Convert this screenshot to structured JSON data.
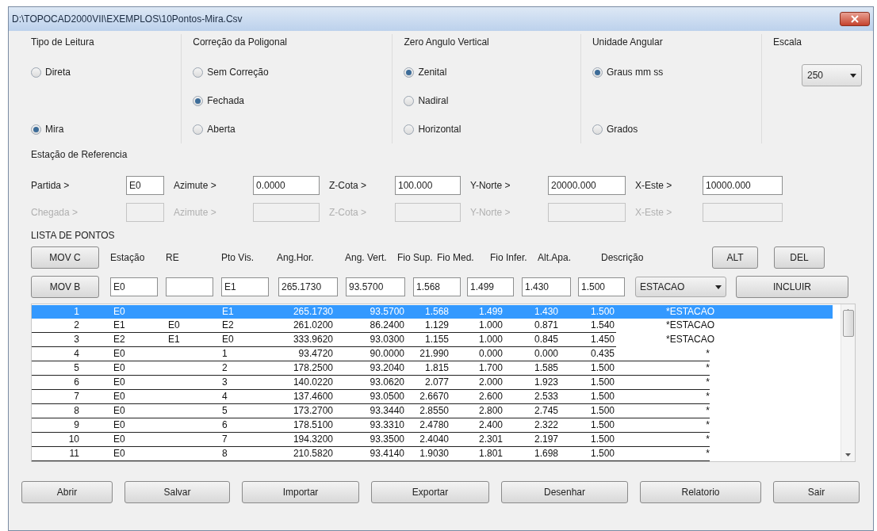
{
  "window": {
    "title": "D:\\TOPOCAD2000VII\\EXEMPLOS\\10Pontos-Mira.Csv"
  },
  "option_groups": [
    {
      "title": "Tipo de Leitura",
      "options": [
        {
          "label": "Direta",
          "selected": false
        },
        {
          "label": "Mira",
          "selected": true
        }
      ]
    },
    {
      "title": "Correção da Poligonal",
      "options": [
        {
          "label": "Sem Correção",
          "selected": false
        },
        {
          "label": "Fechada",
          "selected": true
        },
        {
          "label": "Aberta",
          "selected": false
        }
      ]
    },
    {
      "title": "Zero Angulo Vertical",
      "options": [
        {
          "label": "Zenital",
          "selected": true
        },
        {
          "label": "Nadiral",
          "selected": false
        },
        {
          "label": "Horizontal",
          "selected": false
        }
      ]
    },
    {
      "title": "Unidade Angular",
      "options": [
        {
          "label": "Graus mm ss",
          "selected": true
        },
        {
          "label": "Grados",
          "selected": false
        }
      ]
    }
  ],
  "escala": {
    "title": "Escala",
    "value": "250"
  },
  "reference": {
    "title": "Estação de Referencia",
    "rows": [
      {
        "disabled": false,
        "fields": [
          {
            "label": "Partida >",
            "value": "E0"
          },
          {
            "label": "Azimute >",
            "value": "0.0000"
          },
          {
            "label": "Z-Cota >",
            "value": "100.000"
          },
          {
            "label": "Y-Norte >",
            "value": "20000.000"
          },
          {
            "label": "X-Este >",
            "value": "10000.000"
          }
        ]
      },
      {
        "disabled": true,
        "fields": [
          {
            "label": "Chegada >"
          },
          {
            "label": "Azimute >"
          },
          {
            "label": "Z-Cota >"
          },
          {
            "label": "Y-Norte >"
          },
          {
            "label": "X-Este >"
          }
        ]
      }
    ]
  },
  "points": {
    "title": "LISTA DE PONTOS",
    "mov_buttons": [
      "MOV C",
      "MOV B"
    ],
    "columns": [
      "Estação",
      "RE",
      "Pto Vis.",
      "Ang.Hor.",
      "Ang. Vert.",
      "Fio Sup.",
      "Fio Med.",
      "Fio Infer.",
      "Alt.Apa.",
      "Descrição"
    ],
    "side_buttons": [
      "ALT",
      "DEL"
    ],
    "entry": {
      "estacao": "E0",
      "pto_vis": "E1",
      "ang_hor": "265.1730",
      "ang_vert": "93.5700",
      "fio_sup": "1.568",
      "fio_med": "1.499",
      "fio_infer": "1.430",
      "alt_apa": "1.500",
      "descricao": "ESTACAO"
    },
    "include_button": "INCLUIR",
    "rows": [
      {
        "n": "1",
        "estacao": "E0",
        "pto_vis": "E1",
        "ang_hor": "265.1730",
        "ang_vert": "93.5700",
        "fio_sup": "1.568",
        "fio_med": "1.499",
        "fio_infer": "1.430",
        "alt_apa": "1.500",
        "descricao": "*ESTACAO",
        "selected": true
      },
      {
        "n": "2",
        "estacao": "E1",
        "re": "E0",
        "pto_vis": "E2",
        "ang_hor": "261.0200",
        "ang_vert": "86.2400",
        "fio_sup": "1.129",
        "fio_med": "1.000",
        "fio_infer": "0.871",
        "alt_apa": "1.540",
        "descricao": "*ESTACAO",
        "selected": false
      },
      {
        "n": "3",
        "estacao": "E2",
        "re": "E1",
        "pto_vis": "E0",
        "ang_hor": "333.9620",
        "ang_vert": "93.0300",
        "fio_sup": "1.155",
        "fio_med": "1.000",
        "fio_infer": "0.845",
        "alt_apa": "1.450",
        "descricao": "*ESTACAO",
        "selected": false
      },
      {
        "n": "4",
        "estacao": "E0",
        "pto_vis": "1",
        "ang_hor": "93.4720",
        "ang_vert": "90.0000",
        "fio_sup": "21.990",
        "fio_med": "0.000",
        "fio_infer": "0.000",
        "alt_apa": "0.435",
        "descricao": "*",
        "selected": false
      },
      {
        "n": "5",
        "estacao": "E0",
        "pto_vis": "2",
        "ang_hor": "178.2500",
        "ang_vert": "93.2040",
        "fio_sup": "1.815",
        "fio_med": "1.700",
        "fio_infer": "1.585",
        "alt_apa": "1.500",
        "descricao": "*",
        "selected": false
      },
      {
        "n": "6",
        "estacao": "E0",
        "pto_vis": "3",
        "ang_hor": "140.0220",
        "ang_vert": "93.0620",
        "fio_sup": "2.077",
        "fio_med": "2.000",
        "fio_infer": "1.923",
        "alt_apa": "1.500",
        "descricao": "*",
        "selected": false
      },
      {
        "n": "7",
        "estacao": "E0",
        "pto_vis": "4",
        "ang_hor": "137.4600",
        "ang_vert": "93.0500",
        "fio_sup": "2.6670",
        "fio_med": "2.600",
        "fio_infer": "2.533",
        "alt_apa": "1.500",
        "descricao": "*",
        "selected": false
      },
      {
        "n": "8",
        "estacao": "E0",
        "pto_vis": "5",
        "ang_hor": "173.2700",
        "ang_vert": "93.3440",
        "fio_sup": "2.8550",
        "fio_med": "2.800",
        "fio_infer": "2.745",
        "alt_apa": "1.500",
        "descricao": "*",
        "selected": false
      },
      {
        "n": "9",
        "estacao": "E0",
        "pto_vis": "6",
        "ang_hor": "178.5100",
        "ang_vert": "93.3310",
        "fio_sup": "2.4780",
        "fio_med": "2.400",
        "fio_infer": "2.322",
        "alt_apa": "1.500",
        "descricao": "*",
        "selected": false
      },
      {
        "n": "10",
        "estacao": "E0",
        "pto_vis": "7",
        "ang_hor": "194.3200",
        "ang_vert": "93.3500",
        "fio_sup": "2.4040",
        "fio_med": "2.301",
        "fio_infer": "2.197",
        "alt_apa": "1.500",
        "descricao": "*",
        "selected": false
      },
      {
        "n": "11",
        "estacao": "E0",
        "pto_vis": "8",
        "ang_hor": "210.5820",
        "ang_vert": "93.4140",
        "fio_sup": "1.9030",
        "fio_med": "1.801",
        "fio_infer": "1.698",
        "alt_apa": "1.500",
        "descricao": "*",
        "selected": false
      }
    ]
  },
  "bottom_buttons": [
    "Abrir",
    "Salvar",
    "Importar",
    "Exportar",
    "Desenhar",
    "Relatorio",
    "Sair"
  ]
}
